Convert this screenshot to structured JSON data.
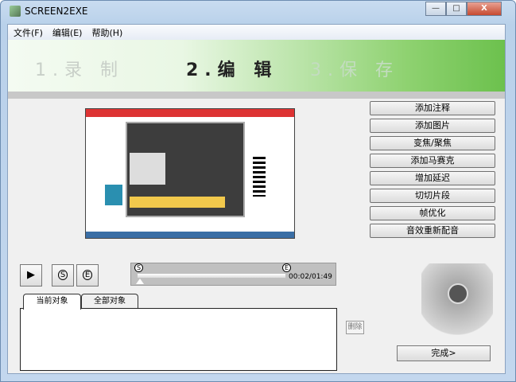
{
  "window": {
    "title": "SCREEN2EXE",
    "controls": [
      "—",
      "□",
      "X"
    ]
  },
  "menu": [
    "文件(F)",
    "编辑(E)",
    "帮助(H)"
  ],
  "steps": [
    {
      "label": "1.录 制",
      "active": false
    },
    {
      "label": "2.编 辑",
      "active": true
    },
    {
      "label": "3.保 存",
      "active": false
    }
  ],
  "actions": [
    "添加注释",
    "添加图片",
    "变焦/聚焦",
    "添加马赛克",
    "增加延迟",
    "切切片段",
    "帧优化",
    "音效重新配音"
  ],
  "playback": {
    "play": "▶",
    "start_marker": "S",
    "end_marker": "E",
    "time": "00:02/01:49",
    "progress": 0.02
  },
  "tabs": [
    "当前对象",
    "全部对象"
  ],
  "delete_label": "删除",
  "finish_label": "完成>",
  "colors": {
    "banner_green": "#6cc14d",
    "active_step": "#222222",
    "inactive_step": "#c8cfc8"
  }
}
